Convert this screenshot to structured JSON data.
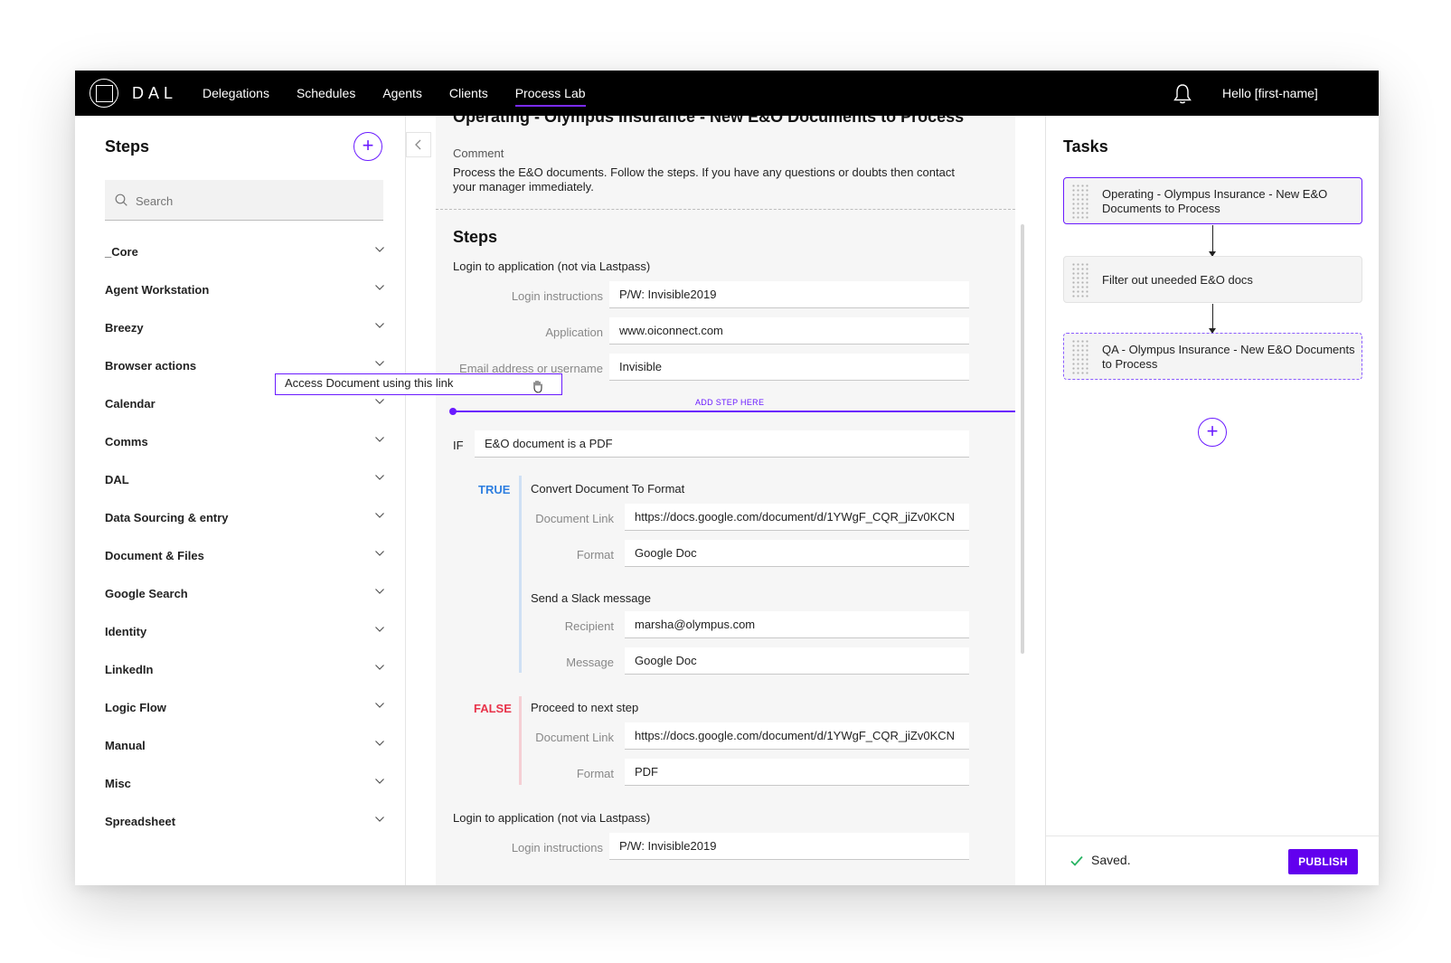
{
  "app": {
    "brand": "DAL",
    "greeting": "Hello [first-name]"
  },
  "nav": [
    {
      "label": "Delegations"
    },
    {
      "label": "Schedules"
    },
    {
      "label": "Agents"
    },
    {
      "label": "Clients"
    },
    {
      "label": "Process Lab",
      "active": true
    }
  ],
  "sidebar": {
    "title": "Steps",
    "add_icon": "+",
    "search_placeholder": "Search",
    "items": [
      {
        "label": "_Core"
      },
      {
        "label": "Agent Workstation"
      },
      {
        "label": "Breezy"
      },
      {
        "label": "Browser actions"
      },
      {
        "label": "Calendar"
      },
      {
        "label": "Comms"
      },
      {
        "label": "DAL"
      },
      {
        "label": "Data Sourcing & entry"
      },
      {
        "label": "Document & Files"
      },
      {
        "label": "Google Search"
      },
      {
        "label": "Identity"
      },
      {
        "label": "LinkedIn"
      },
      {
        "label": "Logic Flow"
      },
      {
        "label": "Manual"
      },
      {
        "label": "Misc"
      },
      {
        "label": "Spreadsheet"
      }
    ],
    "drag_item": "Access Document using this link"
  },
  "main": {
    "title": "Operating - Olympus Insurance - New E&O Documents to Process",
    "comment_label": "Comment",
    "comment_text": "Process the E&O documents. Follow the steps. If you have any questions or doubts then contact your manager immediately.",
    "steps_heading": "Steps",
    "step1": {
      "title": "Login to application (not via Lastpass)",
      "fields": [
        {
          "label": "Login instructions",
          "value": "P/W: Invisible2019"
        },
        {
          "label": "Application",
          "value": "www.oiconnect.com"
        },
        {
          "label": "Email address or username",
          "value": "Invisible"
        }
      ]
    },
    "add_step_label": "ADD STEP HERE",
    "if_label": "IF",
    "if_condition": "E&O document is a PDF",
    "true_label": "TRUE",
    "true_steps": [
      {
        "title": "Convert Document To Format",
        "fields": [
          {
            "label": "Document Link",
            "value": "https://docs.google.com/document/d/1YWgF_CQR_jiZv0KCN"
          },
          {
            "label": "Format",
            "value": "Google Doc"
          }
        ]
      },
      {
        "title": "Send a Slack message",
        "fields": [
          {
            "label": "Recipient",
            "value": "marsha@olympus.com"
          },
          {
            "label": "Message",
            "value": "Google Doc"
          }
        ]
      }
    ],
    "false_label": "FALSE",
    "false_step": {
      "title": "Proceed to next step",
      "fields": [
        {
          "label": "Document Link",
          "value": "https://docs.google.com/document/d/1YWgF_CQR_jiZv0KCN"
        },
        {
          "label": "Format",
          "value": "PDF"
        }
      ]
    },
    "step_last": {
      "title": "Login to application (not via Lastpass)",
      "fields": [
        {
          "label": "Login instructions",
          "value": "P/W: Invisible2019"
        }
      ]
    }
  },
  "tasks": {
    "title": "Tasks",
    "items": [
      {
        "label": "Operating - Olympus Insurance - New E&O Documents to Process"
      },
      {
        "label": "Filter out uneeded E&O docs"
      },
      {
        "label": "QA - Olympus Insurance - New E&O Documents to Process"
      }
    ],
    "add_icon": "+",
    "saved_text": "Saved.",
    "publish_label": "PUBLISH"
  },
  "colors": {
    "accent": "#6200ee",
    "true": "#2f7fe0",
    "false": "#e8334a"
  }
}
